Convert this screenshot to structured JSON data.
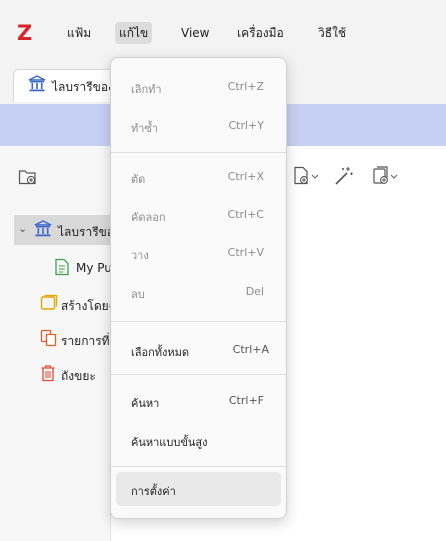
{
  "app": {
    "logo_text": "Z",
    "brand_color": "#d8232a"
  },
  "menubar": {
    "items": [
      {
        "label": "แฟ้ม"
      },
      {
        "label": "แก้ไข"
      },
      {
        "label": "View"
      },
      {
        "label": "เครื่องมือ"
      },
      {
        "label": "วิธีใช้"
      }
    ]
  },
  "tab": {
    "label": "ไลบรารีของฉัน",
    "icon": "library-icon"
  },
  "tree": {
    "root_label": "ไลบรารีของฉัน",
    "items": [
      {
        "label": "My Publications",
        "icon": "publications-icon"
      },
      {
        "label": "สร้างโดยฉัน",
        "icon": "folder-icon"
      },
      {
        "label": "รายการที่ซ้ำกัน",
        "icon": "duplicate-icon"
      },
      {
        "label": "ถังขยะ",
        "icon": "trash-icon"
      }
    ]
  },
  "edit_menu": {
    "items": [
      {
        "label": "เลิกทำ",
        "shortcut": "Ctrl+Z",
        "disabled": true
      },
      {
        "label": "ทำซ้ำ",
        "shortcut": "Ctrl+Y",
        "disabled": true
      },
      {
        "label": "ตัด",
        "shortcut": "Ctrl+X",
        "disabled": true
      },
      {
        "label": "คัดลอก",
        "shortcut": "Ctrl+C",
        "disabled": true
      },
      {
        "label": "วาง",
        "shortcut": "Ctrl+V",
        "disabled": true
      },
      {
        "label": "ลบ",
        "shortcut": "Del",
        "disabled": true
      },
      {
        "label": "เลือกทั้งหมด",
        "shortcut": "Ctrl+A",
        "disabled": false
      },
      {
        "label": "ค้นหา",
        "shortcut": "Ctrl+F",
        "disabled": false
      },
      {
        "label": "ค้นหาแบบขั้นสูง",
        "shortcut": "",
        "disabled": false
      },
      {
        "label": "การตั้งค่า",
        "shortcut": "",
        "disabled": false
      }
    ]
  },
  "colors": {
    "selected_band": "#c6d0f3",
    "library_icon": "#3a67c8",
    "publications_icon": "#3fa34d",
    "folder_icon": "#e8a400",
    "duplicate_icon": "#e85a2b",
    "trash_icon": "#e24b3b"
  }
}
